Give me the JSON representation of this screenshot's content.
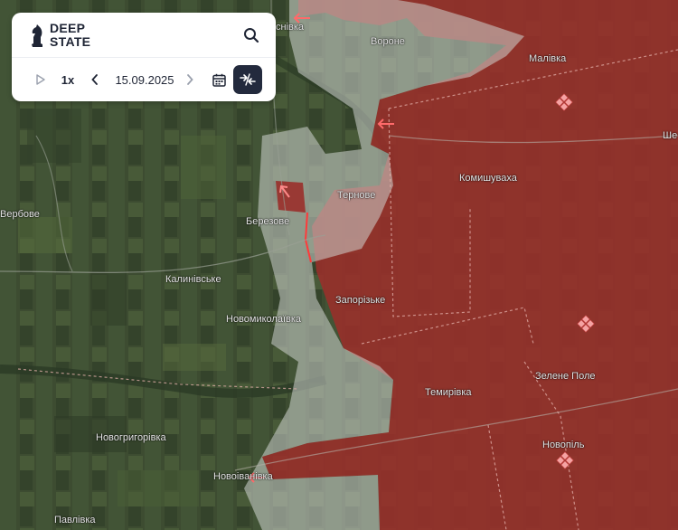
{
  "app": {
    "logo_line1": "DEEP",
    "logo_line2": "STATE"
  },
  "controls": {
    "speed": "1x",
    "date": "15.09.2025"
  },
  "icons": [
    "knight-logo-icon",
    "search-icon",
    "play-icon",
    "chevron-left-icon",
    "chevron-right-icon",
    "calendar-icon",
    "compare-swap-icon",
    "attack-arrow-icon",
    "fortification-diamond-icon"
  ],
  "colors": {
    "occupied": "#9a2f2a",
    "contested": "#cfd3cf",
    "panel_bg": "#ffffff",
    "accent_button": "#232a3d",
    "arrow": "#ff6a6a"
  },
  "places": [
    {
      "id": "voronove",
      "label": "Вороне"
    },
    {
      "id": "malivka",
      "label": "Малівка"
    },
    {
      "id": "sivka",
      "label": "снівка"
    },
    {
      "id": "she",
      "label": "Ше"
    },
    {
      "id": "komyshuvakha",
      "label": "Комишуваха"
    },
    {
      "id": "ternove",
      "label": "Тернове"
    },
    {
      "id": "berezove",
      "label": "Березове"
    },
    {
      "id": "verbove",
      "label": "Вербове"
    },
    {
      "id": "kalynivske",
      "label": "Калинівське"
    },
    {
      "id": "zaporizke",
      "label": "Запорізьке"
    },
    {
      "id": "novomykolaivka",
      "label": "Новомиколаївка"
    },
    {
      "id": "zelene-pole",
      "label": "Зелене Поле"
    },
    {
      "id": "temyrivka",
      "label": "Темирівка"
    },
    {
      "id": "novohryhorivka",
      "label": "Новогригорівка"
    },
    {
      "id": "novopil",
      "label": "Новопіль"
    },
    {
      "id": "novoivanivka",
      "label": "Новоіванівка"
    },
    {
      "id": "pavlivka",
      "label": "Павлівка"
    }
  ]
}
